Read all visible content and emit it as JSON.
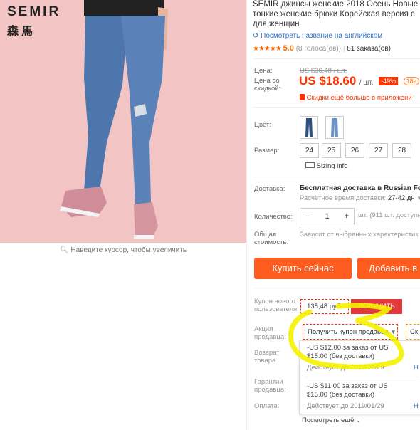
{
  "brand": {
    "name_en": "SEMIR",
    "name_cn": "森馬"
  },
  "zoom_hint": "Наведите курсор, чтобы увеличить",
  "product": {
    "title_lines": [
      "SEMIR джинсы женские 2018 Осень Новые д",
      "тонкие женские брюки Корейская версия с",
      "для женщин"
    ],
    "translate_link": "Посмотреть название на английском",
    "rating_value": "5.0",
    "rating_votes": "(8 голоса(ов))",
    "orders": "81 заказа(ов)"
  },
  "price": {
    "label": "Цена:",
    "old": "US $36.48 / шт.",
    "discount_label": "Цена со скидкой:",
    "new": "US $18.60",
    "unit": "/ шт.",
    "discount_badge": "-49%",
    "timer_badge": "18ч",
    "app_promo": "Скидки ещё больше в приложени"
  },
  "color": {
    "label": "Цвет:"
  },
  "size": {
    "label": "Размер:",
    "options": [
      "24",
      "25",
      "26",
      "27",
      "28"
    ],
    "sizing_info": "Sizing info"
  },
  "shipping": {
    "label": "Доставка:",
    "value": "Бесплатная доставка в Russian Fede",
    "time_label": "Расчётное время доставки:",
    "time_value": "27-42 дн"
  },
  "quantity": {
    "label": "Количество:",
    "value": "1",
    "minus": "−",
    "plus": "+",
    "stock": "шт. (911 шт. доступн"
  },
  "total": {
    "label": "Общая стоимость:",
    "value": "Зависит от выбранных характеристик"
  },
  "actions": {
    "buy_now": "Купить сейчас",
    "add_to_cart": "Добавить в"
  },
  "coupon_new": {
    "label": "Купон нового пользователя",
    "amount": "135,48 руб.",
    "button": "ПОЛУЧИТЬ"
  },
  "seller_promo": {
    "label": "Акция продавца:",
    "dropdown": "Получить купон продавца",
    "second": "Ск"
  },
  "returns": {
    "label": "Возврат товара"
  },
  "guarantee": {
    "label": "Гарантии продавца:"
  },
  "payment": {
    "label": "Оплата:"
  },
  "coupons": [
    {
      "text": "-US $12.00 за заказ от US $15.00 (без доставки)",
      "valid": "Действует до 2019/01/29",
      "action": "Н"
    },
    {
      "text": "-US $11.00 за заказ от US $15.00 (без доставки)",
      "valid": "Действует до 2019/01/29",
      "action": "Н"
    }
  ],
  "see_more": "Посмотреть ещё",
  "colors": {
    "accent": "#ff5d1f",
    "price_red": "#f30",
    "link": "#2e73c9",
    "highlight": "#f5f200"
  }
}
